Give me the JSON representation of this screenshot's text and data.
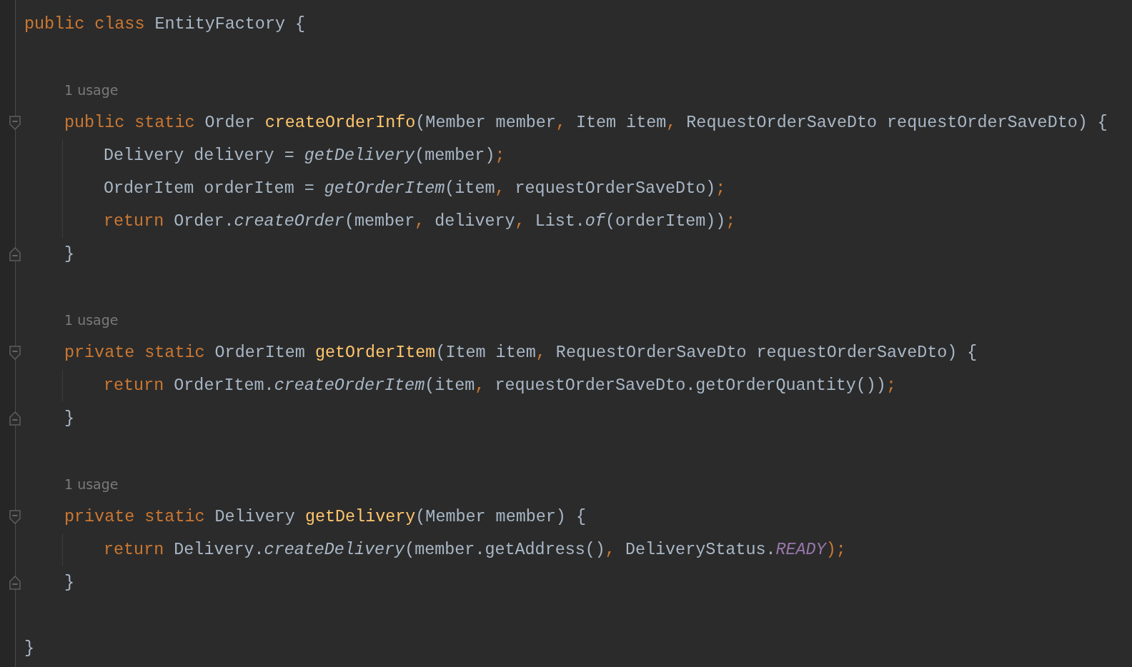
{
  "class": {
    "header": [
      {
        "kind": "kw",
        "text": "public class "
      },
      {
        "kind": "plain",
        "text": "EntityFactory {"
      }
    ],
    "members": [
      {
        "usage": "1 usage",
        "signature": [
          {
            "kind": "kw",
            "text": "public static "
          },
          {
            "kind": "plain",
            "text": "Order "
          },
          {
            "kind": "decl",
            "text": "createOrderInfo"
          },
          {
            "kind": "plain",
            "text": "(Member member"
          },
          {
            "kind": "punct",
            "text": ", "
          },
          {
            "kind": "plain",
            "text": "Item item"
          },
          {
            "kind": "punct",
            "text": ", "
          },
          {
            "kind": "plain",
            "text": "RequestOrderSaveDto requestOrderSaveDto) {"
          }
        ],
        "body": [
          [
            {
              "kind": "plain",
              "text": "Delivery delivery = "
            },
            {
              "kind": "call",
              "text": "getDelivery"
            },
            {
              "kind": "plain",
              "text": "(member)"
            },
            {
              "kind": "punct",
              "text": ";"
            }
          ],
          [
            {
              "kind": "plain",
              "text": "OrderItem orderItem = "
            },
            {
              "kind": "call",
              "text": "getOrderItem"
            },
            {
              "kind": "plain",
              "text": "(item"
            },
            {
              "kind": "punct",
              "text": ", "
            },
            {
              "kind": "plain",
              "text": "requestOrderSaveDto)"
            },
            {
              "kind": "punct",
              "text": ";"
            }
          ],
          [
            {
              "kind": "kw",
              "text": "return "
            },
            {
              "kind": "plain",
              "text": "Order."
            },
            {
              "kind": "call",
              "text": "createOrder"
            },
            {
              "kind": "plain",
              "text": "(member"
            },
            {
              "kind": "punct",
              "text": ", "
            },
            {
              "kind": "plain",
              "text": "delivery"
            },
            {
              "kind": "punct",
              "text": ", "
            },
            {
              "kind": "plain",
              "text": "List."
            },
            {
              "kind": "call",
              "text": "of"
            },
            {
              "kind": "plain",
              "text": "(orderItem))"
            },
            {
              "kind": "punct",
              "text": ";"
            }
          ]
        ],
        "closing": "}"
      },
      {
        "usage": "1 usage",
        "signature": [
          {
            "kind": "kw",
            "text": "private static "
          },
          {
            "kind": "plain",
            "text": "OrderItem "
          },
          {
            "kind": "decl",
            "text": "getOrderItem"
          },
          {
            "kind": "plain",
            "text": "(Item item"
          },
          {
            "kind": "punct",
            "text": ", "
          },
          {
            "kind": "plain",
            "text": "RequestOrderSaveDto requestOrderSaveDto) {"
          }
        ],
        "body": [
          [
            {
              "kind": "kw",
              "text": "return "
            },
            {
              "kind": "plain",
              "text": "OrderItem."
            },
            {
              "kind": "call",
              "text": "createOrderItem"
            },
            {
              "kind": "plain",
              "text": "(item"
            },
            {
              "kind": "punct",
              "text": ", "
            },
            {
              "kind": "plain",
              "text": "requestOrderSaveDto.getOrderQuantity())"
            },
            {
              "kind": "punct",
              "text": ";"
            }
          ]
        ],
        "closing": "}"
      },
      {
        "usage": "1 usage",
        "signature": [
          {
            "kind": "kw",
            "text": "private static "
          },
          {
            "kind": "plain",
            "text": "Delivery "
          },
          {
            "kind": "decl",
            "text": "getDelivery"
          },
          {
            "kind": "plain",
            "text": "(Member member) {"
          }
        ],
        "body": [
          [
            {
              "kind": "kw",
              "text": "return "
            },
            {
              "kind": "plain",
              "text": "Delivery."
            },
            {
              "kind": "call",
              "text": "createDelivery"
            },
            {
              "kind": "plain",
              "text": "(member.getAddress()"
            },
            {
              "kind": "punct",
              "text": ", "
            },
            {
              "kind": "plain",
              "text": "DeliveryStatus."
            },
            {
              "kind": "const",
              "text": "READY"
            },
            {
              "kind": "punct",
              "text": ")"
            },
            {
              "kind": "punct",
              "text": ";"
            }
          ]
        ],
        "closing": "}"
      }
    ],
    "closing": "}"
  }
}
